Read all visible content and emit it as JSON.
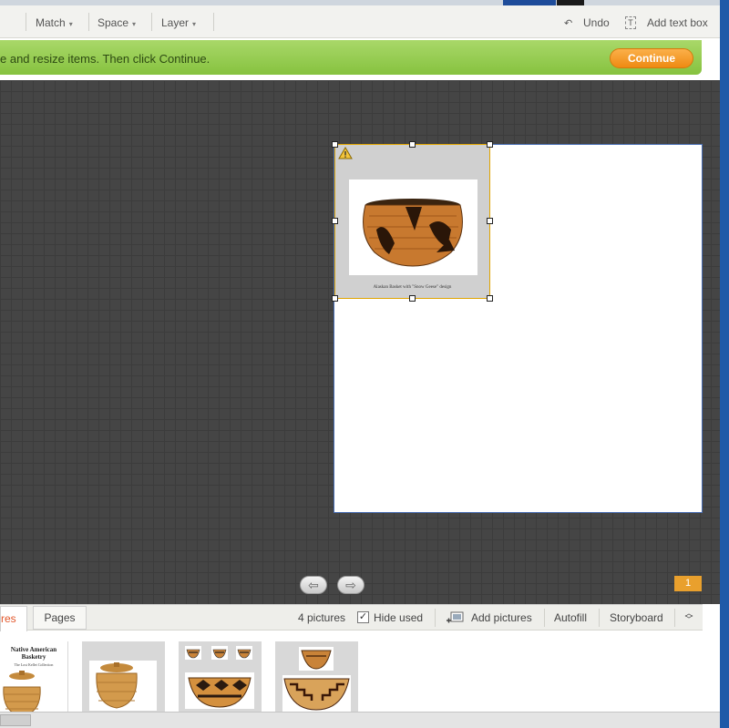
{
  "toolbar": {
    "items": [
      {
        "label": "Match",
        "dropdown": "▾"
      },
      {
        "label": "Space",
        "dropdown": "▾"
      },
      {
        "label": "Layer",
        "dropdown": "▾"
      }
    ],
    "undo_label": "Undo",
    "add_text_box_label": "Add text box"
  },
  "instruction": {
    "message": "e and resize items. Then click Continue.",
    "continue_label": "Continue"
  },
  "photo": {
    "caption": "Alaskan Basket with \"Snow Geese\" design"
  },
  "pager": {
    "prev_icon": "⇦",
    "next_icon": "⇨",
    "page_number": "1"
  },
  "tray": {
    "active_tab_label": "res",
    "pages_tab_label": "Pages",
    "picture_count": "4 pictures",
    "hide_used_label": "Hide used",
    "hide_used_checked": "✓",
    "add_pictures_label": "Add pictures",
    "autofill_label": "Autofill",
    "storyboard_label": "Storyboard",
    "thumbnails": [
      {
        "title": "Native American Basketry",
        "subtitle": "The Lost Kellet Collection"
      },
      {
        "title": ""
      },
      {
        "title": ""
      },
      {
        "title": ""
      }
    ]
  },
  "colors": {
    "accent_orange": "#ee8a12",
    "green_bar": "#86c23f",
    "canvas": "#454545",
    "page_border": "#4a6fb4"
  }
}
